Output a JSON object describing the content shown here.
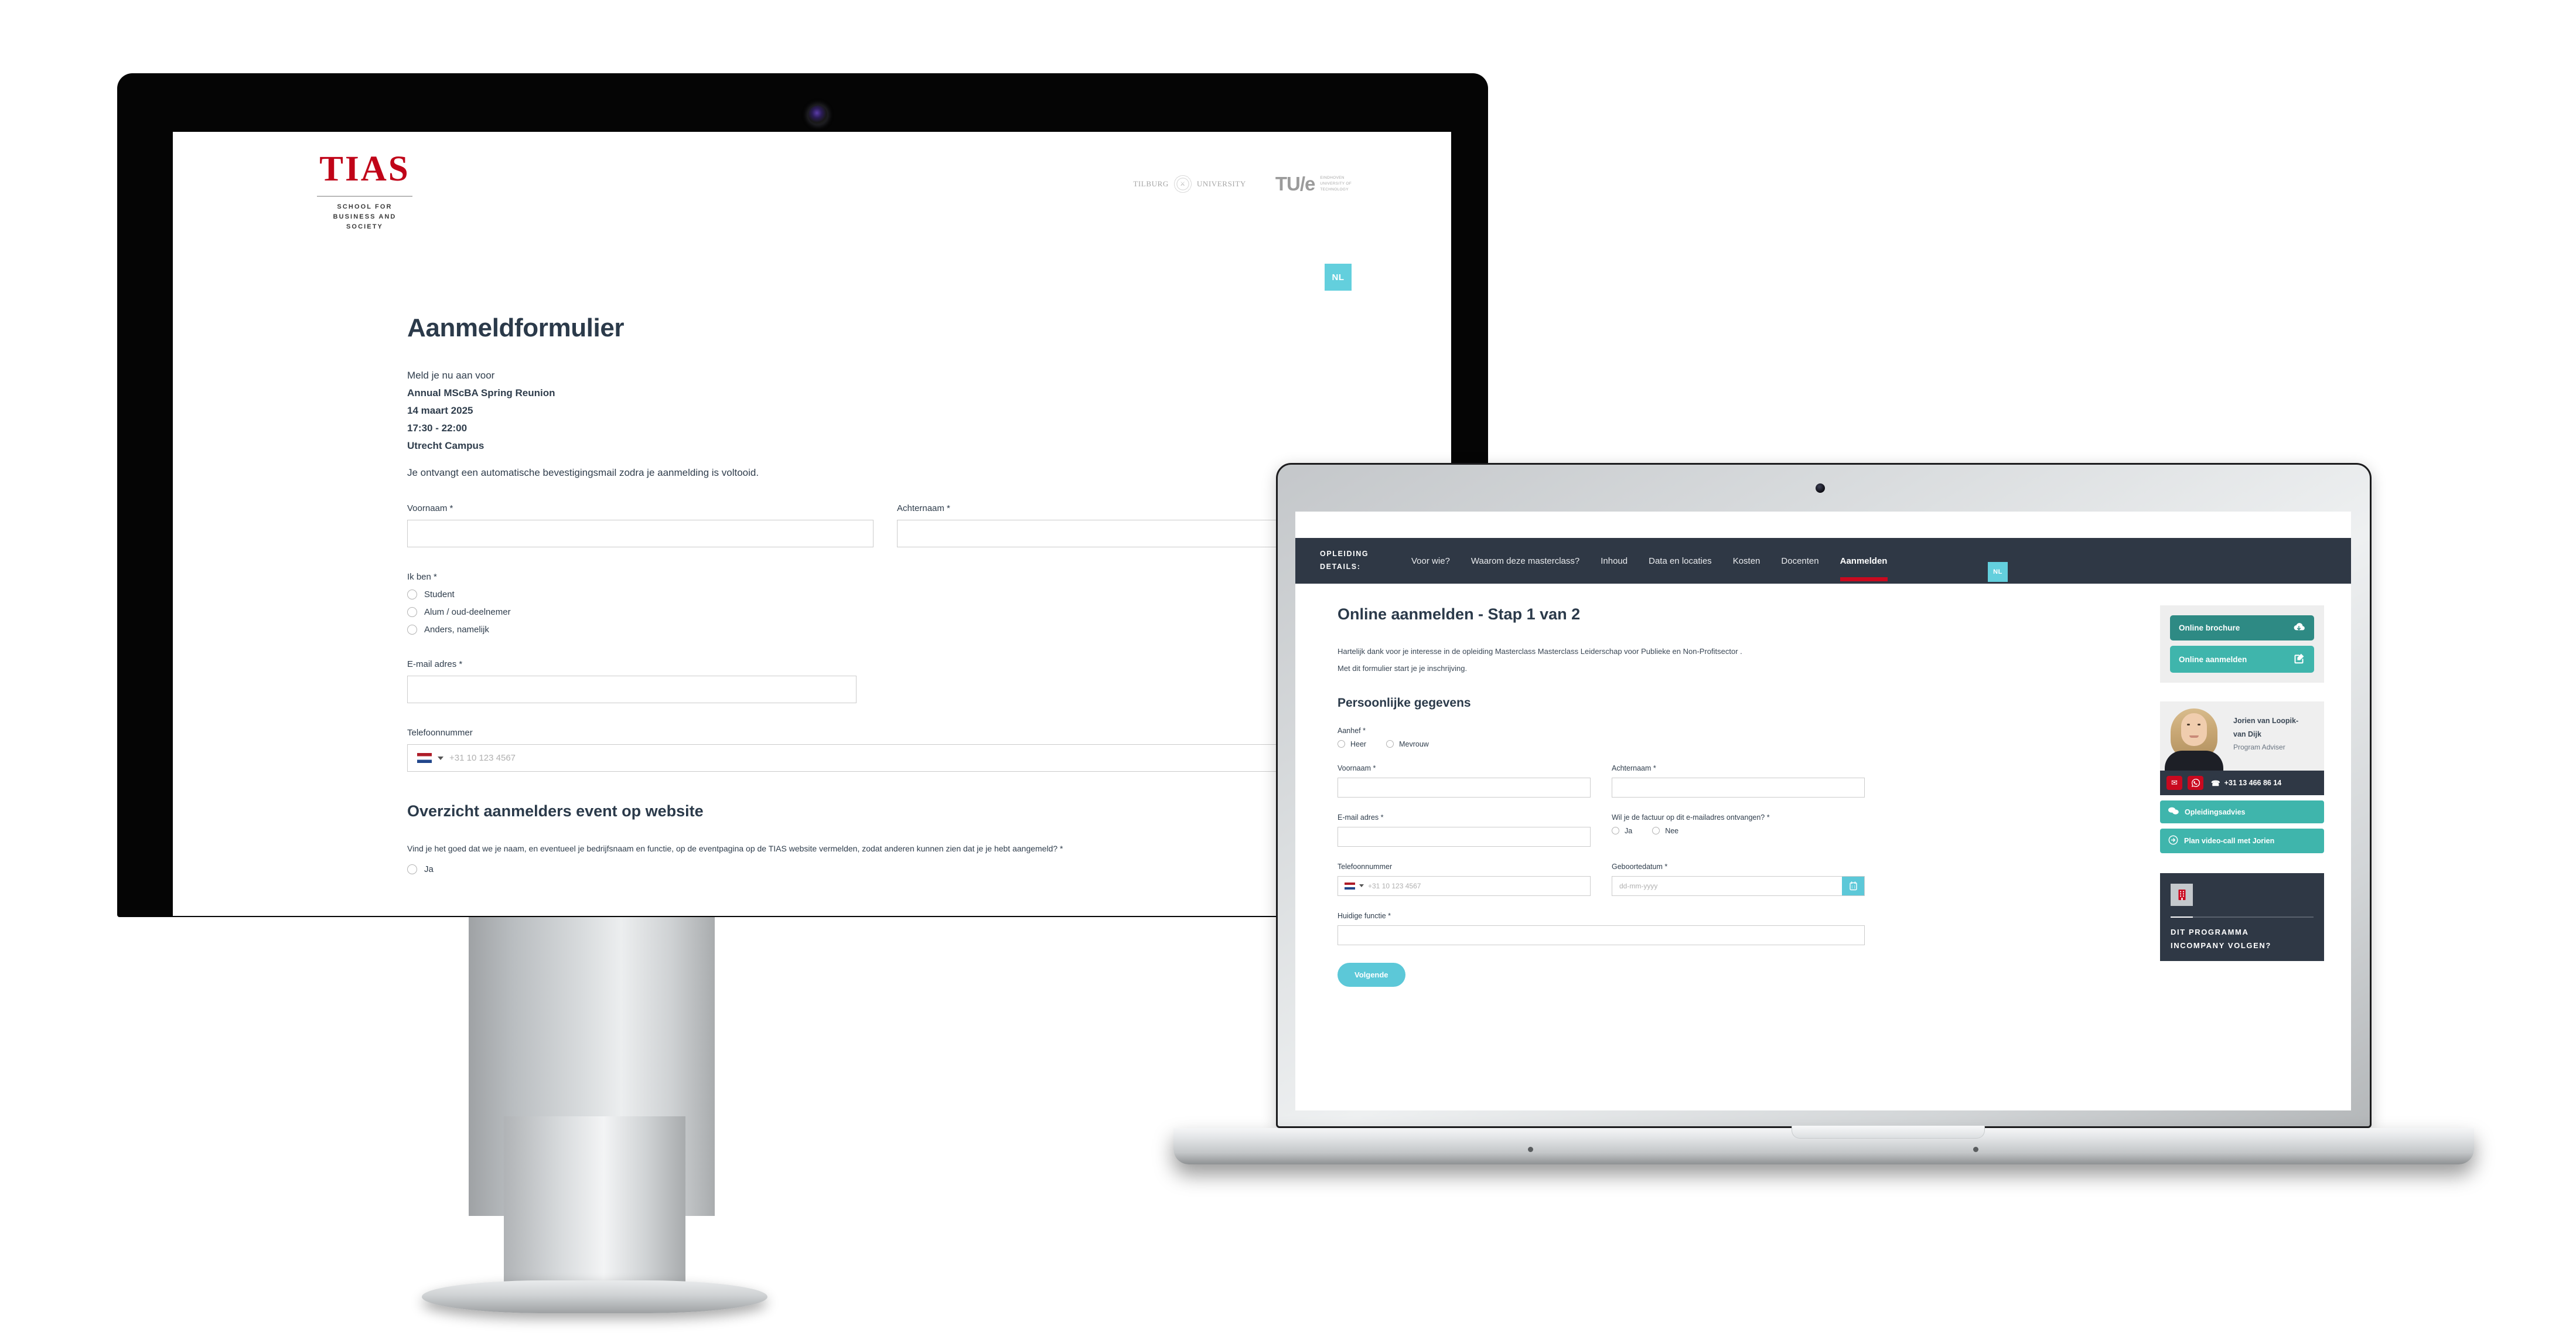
{
  "desktop": {
    "logo": {
      "word": "TIAS",
      "sub_line1": "SCHOOL FOR",
      "sub_line2": "BUSINESS AND SOCIETY"
    },
    "partners": {
      "tilburg_left": "TILBURG",
      "tilburg_right": "UNIVERSITY",
      "tue_logo": "TU/e",
      "tue_line1": "EINDHOVEN",
      "tue_line2": "UNIVERSITY OF",
      "tue_line3": "TECHNOLOGY"
    },
    "language_badge": "NL",
    "title": "Aanmeldformulier",
    "intro_lead": "Meld je nu aan voor",
    "event_name": "Annual MScBA Spring Reunion",
    "event_date": "14 maart 2025",
    "event_time": "17:30 - 22:00",
    "event_location": "Utrecht Campus",
    "confirmation_note": "Je ontvangt een automatische bevestigingsmail zodra je aanmelding is voltooid.",
    "fields": {
      "voornaam_label": "Voornaam *",
      "achternaam_label": "Achternaam *",
      "ikben_label": "Ik ben *",
      "ikben_options": [
        "Student",
        "Alum / oud-deelnemer",
        "Anders, namelijk"
      ],
      "email_label": "E-mail adres *",
      "telefoon_label": "Telefoonnummer",
      "telefoon_placeholder": "+31 10 123 4567"
    },
    "section_title": "Overzicht aanmelders event op website",
    "consent_question": "Vind je het goed dat we je naam, en eventueel je bedrijfsnaam en functie, op de eventpagina op de TIAS website vermelden, zodat anderen kunnen zien dat je je hebt aangemeld? *",
    "consent_option_ja": "Ja"
  },
  "laptop": {
    "nav": {
      "brand_line1": "OPLEIDING",
      "brand_line2": "DETAILS:",
      "items": [
        {
          "label": "Voor wie?",
          "active": false
        },
        {
          "label": "Waarom deze masterclass?",
          "active": false
        },
        {
          "label": "Inhoud",
          "active": false
        },
        {
          "label": "Data en locaties",
          "active": false
        },
        {
          "label": "Kosten",
          "active": false
        },
        {
          "label": "Docenten",
          "active": false
        },
        {
          "label": "Aanmelden",
          "active": true
        }
      ],
      "active_color": "#c9091f"
    },
    "language_badge": "NL",
    "heading": "Online aanmelden - Stap 1 van 2",
    "paragraph1": "Hartelijk dank voor je interesse in de opleiding Masterclass Masterclass Leiderschap voor Publieke en Non-Profitsector .",
    "paragraph2": "Met dit formulier start je je inschrijving.",
    "section_heading": "Persoonlijke gegevens",
    "fields": {
      "aanhef_label": "Aanhef *",
      "aanhef_options": [
        "Heer",
        "Mevrouw"
      ],
      "voornaam_label": "Voornaam *",
      "achternaam_label": "Achternaam *",
      "email_label": "E-mail adres *",
      "factuur_label": "Wil je de factuur op dit e-mailadres ontvangen? *",
      "factuur_options": [
        "Ja",
        "Nee"
      ],
      "telefoon_label": "Telefoonnummer",
      "telefoon_placeholder": "+31 10 123 4567",
      "geboortedatum_label": "Geboortedatum *",
      "geboortedatum_placeholder": "dd-mm-yyyy",
      "functie_label": "Huidige functie *"
    },
    "next_button": "Volgende",
    "sidebar": {
      "brochure_button": "Online brochure",
      "brochure_icon": "cloud-download-icon",
      "aanmelden_button": "Online aanmelden",
      "aanmelden_icon": "edit-square-icon",
      "advisor_name_line1": "Jorien van Loopik-",
      "advisor_name_line2": "van Dijk",
      "advisor_role": "Program Adviser",
      "email_icon": "envelope-icon",
      "whatsapp_icon": "whatsapp-icon",
      "phone_icon": "phone-icon",
      "phone_number": "+31 13 466 86 14",
      "advice_button": "Opleidingsadvies",
      "advice_icon": "chat-bubbles-icon",
      "videocall_button": "Plan video-call met Jorien",
      "videocall_icon": "arrow-circle-icon",
      "incompany_icon": "building-icon",
      "incompany_line1": "DIT PROGRAMMA",
      "incompany_line2": "INCOMPANY VOLGEN?"
    }
  },
  "colors": {
    "brand_red": "#c00418",
    "nav_dark": "#2f3845",
    "accent_cyan": "#5cc8d8",
    "accent_teal": "#3fb5ac",
    "accent_teal_dark": "#2e8a84",
    "heading_navy": "#2b3a4a"
  }
}
